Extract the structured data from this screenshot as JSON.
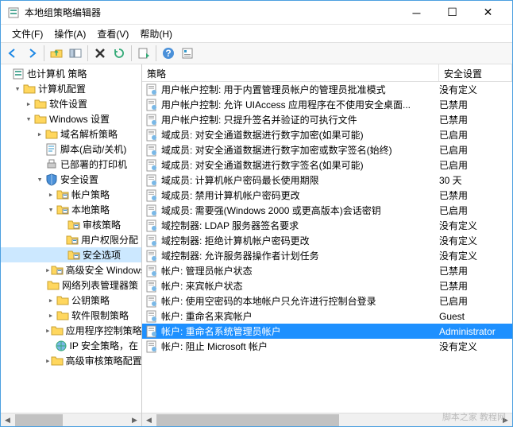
{
  "title": "本地组策略编辑器",
  "menu": [
    "文件(F)",
    "操作(A)",
    "查看(V)",
    "帮助(H)"
  ],
  "tree_root": "也计算机 策略",
  "tree": [
    {
      "label": "计算机配置",
      "indent": 1,
      "exp": "▾",
      "icon": "folder"
    },
    {
      "label": "软件设置",
      "indent": 2,
      "exp": "▸",
      "icon": "folder"
    },
    {
      "label": "Windows 设置",
      "indent": 2,
      "exp": "▾",
      "icon": "folder"
    },
    {
      "label": "域名解析策略",
      "indent": 3,
      "exp": "▸",
      "icon": "folder"
    },
    {
      "label": "脚本(启动/关机)",
      "indent": 3,
      "exp": "",
      "icon": "script"
    },
    {
      "label": "已部署的打印机",
      "indent": 3,
      "exp": "",
      "icon": "printer"
    },
    {
      "label": "安全设置",
      "indent": 3,
      "exp": "▾",
      "icon": "shield"
    },
    {
      "label": "帐户策略",
      "indent": 4,
      "exp": "▸",
      "icon": "pfolder"
    },
    {
      "label": "本地策略",
      "indent": 4,
      "exp": "▾",
      "icon": "pfolder"
    },
    {
      "label": "审核策略",
      "indent": 5,
      "exp": "",
      "icon": "pfolder"
    },
    {
      "label": "用户权限分配",
      "indent": 5,
      "exp": "",
      "icon": "pfolder"
    },
    {
      "label": "安全选项",
      "indent": 5,
      "exp": "",
      "icon": "pfolder",
      "selected": true
    },
    {
      "label": "高级安全 Windows",
      "indent": 4,
      "exp": "▸",
      "icon": "pfolder"
    },
    {
      "label": "网络列表管理器策",
      "indent": 4,
      "exp": "",
      "icon": "folder"
    },
    {
      "label": "公钥策略",
      "indent": 4,
      "exp": "▸",
      "icon": "folder"
    },
    {
      "label": "软件限制策略",
      "indent": 4,
      "exp": "▸",
      "icon": "folder"
    },
    {
      "label": "应用程序控制策略",
      "indent": 4,
      "exp": "▸",
      "icon": "folder"
    },
    {
      "label": "IP 安全策略，在",
      "indent": 4,
      "exp": "",
      "icon": "ipsec"
    },
    {
      "label": "高级审核策略配置",
      "indent": 4,
      "exp": "▸",
      "icon": "folder"
    }
  ],
  "columns": {
    "policy": "策略",
    "setting": "安全设置"
  },
  "policies": [
    {
      "name": "用户帐户控制: 用于内置管理员帐户的管理员批准模式",
      "val": "没有定义"
    },
    {
      "name": "用户帐户控制: 允许 UIAccess 应用程序在不使用安全桌面...",
      "val": "已禁用"
    },
    {
      "name": "用户帐户控制: 只提升签名并验证的可执行文件",
      "val": "已禁用"
    },
    {
      "name": "域成员: 对安全通道数据进行数字加密(如果可能)",
      "val": "已启用"
    },
    {
      "name": "域成员: 对安全通道数据进行数字加密或数字签名(始终)",
      "val": "已启用"
    },
    {
      "name": "域成员: 对安全通道数据进行数字签名(如果可能)",
      "val": "已启用"
    },
    {
      "name": "域成员: 计算机帐户密码最长使用期限",
      "val": "30 天"
    },
    {
      "name": "域成员: 禁用计算机帐户密码更改",
      "val": "已禁用"
    },
    {
      "name": "域成员: 需要强(Windows 2000 或更高版本)会话密钥",
      "val": "已启用"
    },
    {
      "name": "域控制器: LDAP 服务器签名要求",
      "val": "没有定义"
    },
    {
      "name": "域控制器: 拒绝计算机帐户密码更改",
      "val": "没有定义"
    },
    {
      "name": "域控制器: 允许服务器操作者计划任务",
      "val": "没有定义"
    },
    {
      "name": "帐户: 管理员帐户状态",
      "val": "已禁用"
    },
    {
      "name": "帐户: 来宾帐户状态",
      "val": "已禁用"
    },
    {
      "name": "帐户: 使用空密码的本地帐户只允许进行控制台登录",
      "val": "已启用"
    },
    {
      "name": "帐户: 重命名来宾帐户",
      "val": "Guest"
    },
    {
      "name": "帐户: 重命名系统管理员帐户",
      "val": "Administrator",
      "selected": true
    },
    {
      "name": "帐户: 阻止 Microsoft 帐户",
      "val": "没有定义"
    }
  ],
  "watermark": "脚本之家 教程网"
}
